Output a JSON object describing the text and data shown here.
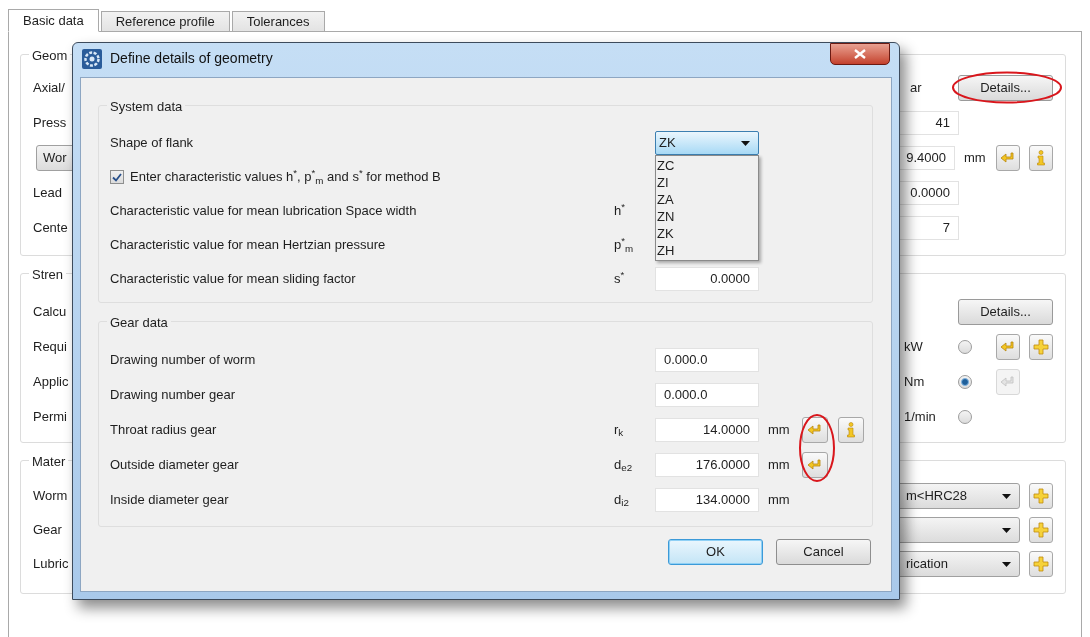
{
  "tabs": [
    {
      "label": "Basic data",
      "selected": true
    },
    {
      "label": "Reference profile",
      "selected": false
    },
    {
      "label": "Tolerances",
      "selected": false
    }
  ],
  "groups": [
    {
      "title": "Geom",
      "rows": [
        {
          "label": "Axial/",
          "kind": "button",
          "text": "ar",
          "button": "Details...",
          "highlighted": true
        },
        {
          "label": "Press",
          "kind": "field",
          "value": "41"
        },
        {
          "label": "Wor",
          "label_button": true,
          "kind": "field_tools",
          "value": "9.4000",
          "unit": "mm"
        },
        {
          "label": "Lead",
          "kind": "field",
          "value": "0.0000"
        },
        {
          "label": "Cente",
          "kind": "field",
          "value": "7"
        }
      ]
    },
    {
      "title": "Stren",
      "rows": [
        {
          "label": "Calcu",
          "kind": "button",
          "button": "Details..."
        },
        {
          "label": "Requi",
          "kind": "radio",
          "unit": "kW",
          "selected": false,
          "arrow": true,
          "arrow_disabled": false,
          "plus": true
        },
        {
          "label": "Applic",
          "kind": "radio",
          "unit": "Nm",
          "selected": true,
          "arrow": true,
          "arrow_disabled": true
        },
        {
          "label": "Permi",
          "kind": "radio",
          "unit": "1/min",
          "selected": false
        }
      ]
    },
    {
      "title": "Mater",
      "rows": [
        {
          "label": "Worm",
          "kind": "select",
          "value": "m<HRC28"
        },
        {
          "label": "Gear",
          "kind": "select"
        },
        {
          "label": "Lubric",
          "kind": "select",
          "value": "rication"
        }
      ]
    }
  ],
  "dialog": {
    "title": "Define details of geometry",
    "system": {
      "title": "System data",
      "shape": {
        "label": "Shape of flank",
        "value": "ZK",
        "expanded": true,
        "options": [
          "ZC",
          "ZI",
          "ZA",
          "ZN",
          "ZK",
          "ZH"
        ]
      },
      "checkbox": {
        "label": "Enter characteristic values h$^{*}$, p$^{*}$$_{m}$ and s$^{*}$ for method B",
        "checked": true
      },
      "rows": [
        {
          "label": "Characteristic value for mean lubrication Space width",
          "symbol": "h$^{*}$"
        },
        {
          "label": "Characteristic value for mean Hertzian pressure",
          "symbol": "p$^{*}$$_{m}$"
        },
        {
          "label": "Characteristic value for mean sliding factor",
          "symbol": "s$^{*}$",
          "value": "0.0000"
        }
      ]
    },
    "gear": {
      "title": "Gear data",
      "arrow_highlight": true,
      "rows": [
        {
          "label": "Drawing number of worm",
          "kind": "text",
          "value": "0.000.0"
        },
        {
          "label": "Drawing number gear",
          "kind": "text",
          "value": "0.000.0"
        },
        {
          "label": "Throat radius gear",
          "kind": "number",
          "symbol": "r$_{k}$",
          "value": "14.0000",
          "unit": "mm",
          "arrow": true,
          "info": true
        },
        {
          "label": "Outside diameter gear",
          "kind": "number",
          "symbol": "d$_{e2}$",
          "value": "176.0000",
          "unit": "mm",
          "arrow": true
        },
        {
          "label": "Inside diameter gear",
          "kind": "number",
          "symbol": "d$_{i2}$",
          "value": "134.0000",
          "unit": "mm"
        }
      ]
    },
    "buttons": [
      {
        "label": "OK",
        "default": true
      },
      {
        "label": "Cancel",
        "default": false
      }
    ]
  }
}
